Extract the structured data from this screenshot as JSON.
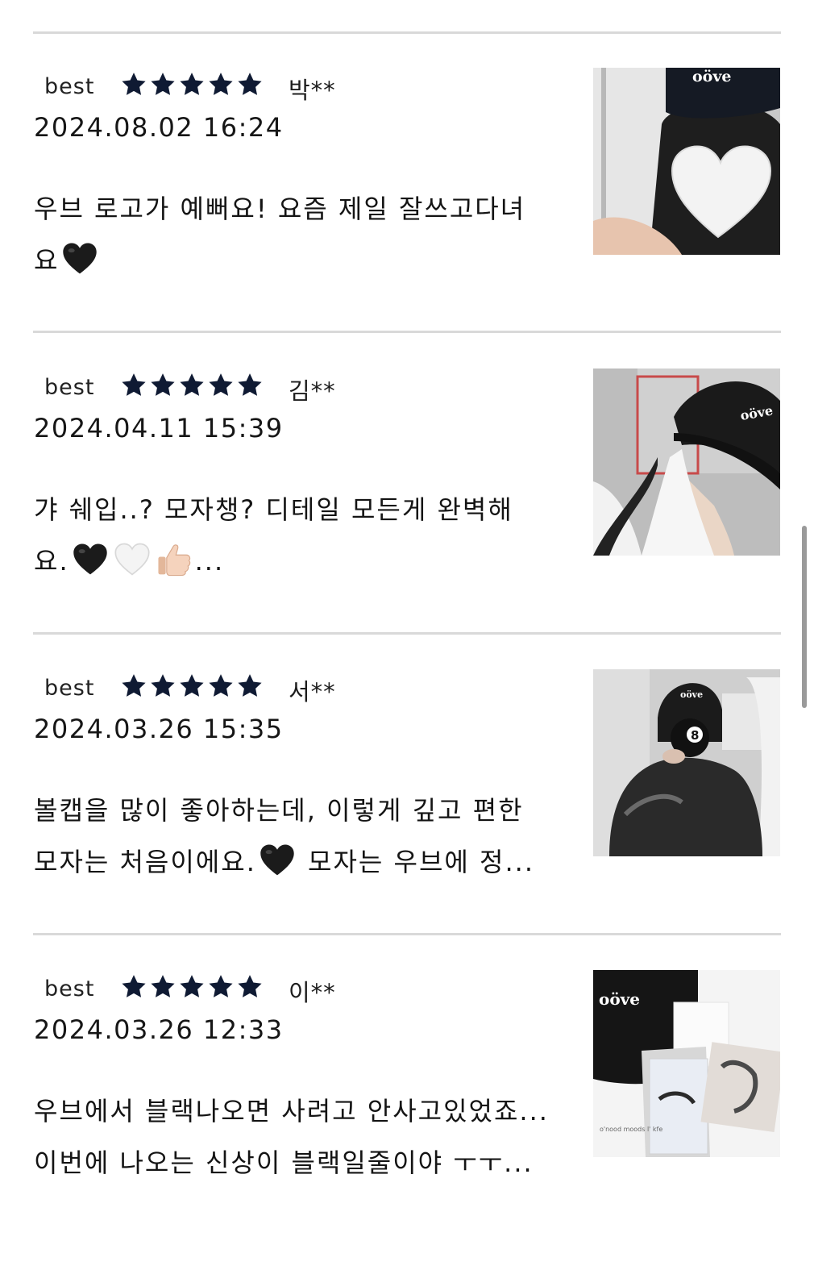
{
  "reviews": [
    {
      "badge": "best",
      "rating": 5,
      "author": "박**",
      "date": "2024.08.02 16:24",
      "lines": [
        {
          "text": "우브 로고가 예뻐요! 요즘 제일 잘쓰고다녀",
          "emoji": []
        },
        {
          "text": "요",
          "emoji": [
            "black-heart"
          ]
        }
      ],
      "photo": {
        "logo": "oöve",
        "icon": "white-heart"
      }
    },
    {
      "badge": "best",
      "rating": 5,
      "author": "김**",
      "date": "2024.04.11 15:39",
      "lines": [
        {
          "text": "갸 쉐입..? 모자챙? 디테일 모든게 완벽해",
          "emoji": []
        },
        {
          "text": "요.",
          "emoji": [
            "black-heart",
            "white-heart",
            "thumbs-up"
          ],
          "suffix": "..."
        }
      ],
      "photo": {
        "logo": "oöve"
      }
    },
    {
      "badge": "best",
      "rating": 5,
      "author": "서**",
      "date": "2024.03.26 15:35",
      "lines": [
        {
          "text": "볼캡을 많이 좋아하는데, 이렇게 깊고 편한",
          "emoji": []
        },
        {
          "text": "모자는 처음이에요.",
          "emoji": [
            "black-heart"
          ],
          "suffix": "모자는 우브에 정..."
        }
      ],
      "photo": {
        "logo": "oöve",
        "icon": "8"
      }
    },
    {
      "badge": "best",
      "rating": 5,
      "author": "이**",
      "date": "2024.03.26 12:33",
      "lines": [
        {
          "text": "우브에서 블랙나오면 사려고 안사고있었죠...",
          "emoji": []
        },
        {
          "text": "이번에 나오는 신상이 블랙일줄이야 ㅜㅜ...",
          "emoji": []
        }
      ],
      "photo": {
        "logo": "oöve"
      }
    }
  ],
  "colors": {
    "star": "#0f1a33",
    "divider": "#d9d9d9",
    "text": "#141414"
  }
}
